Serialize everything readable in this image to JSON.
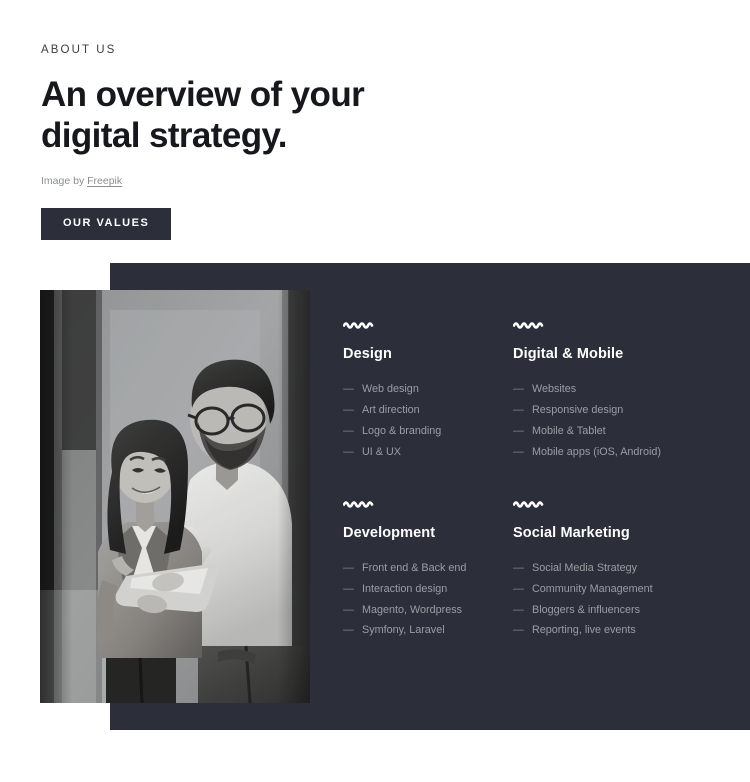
{
  "header": {
    "eyebrow": "ABOUT US",
    "headline_line1": "An overview of your",
    "headline_line2": "digital strategy.",
    "credit_prefix": "Image by ",
    "credit_link": "Freepik",
    "cta_label": "OUR VALUES"
  },
  "photo": {
    "alt": "Two business colleagues reviewing a tablet together, grayscale office photo"
  },
  "services": [
    {
      "title": "Design",
      "items": [
        "Web design",
        "Art direction",
        "Logo & branding",
        "UI & UX"
      ]
    },
    {
      "title": "Digital & Mobile",
      "items": [
        "Websites",
        "Responsive design",
        "Mobile & Tablet",
        "Mobile apps (iOS, Android)"
      ]
    },
    {
      "title": "Development",
      "items": [
        "Front end & Back end",
        "Interaction design",
        "Magento, Wordpress",
        "Symfony, Laravel"
      ]
    },
    {
      "title": "Social Marketing",
      "items": [
        "Social Media Strategy",
        "Community Management",
        "Bloggers & influencers",
        "Reporting, live events"
      ]
    }
  ],
  "colors": {
    "panel_dark": "#2c2f39",
    "page_bg": "#ffffff",
    "heading_dark": "#16181d",
    "list_text": "#9b9da4",
    "muted_text": "#8b8d93",
    "accent_white": "#ffffff"
  }
}
